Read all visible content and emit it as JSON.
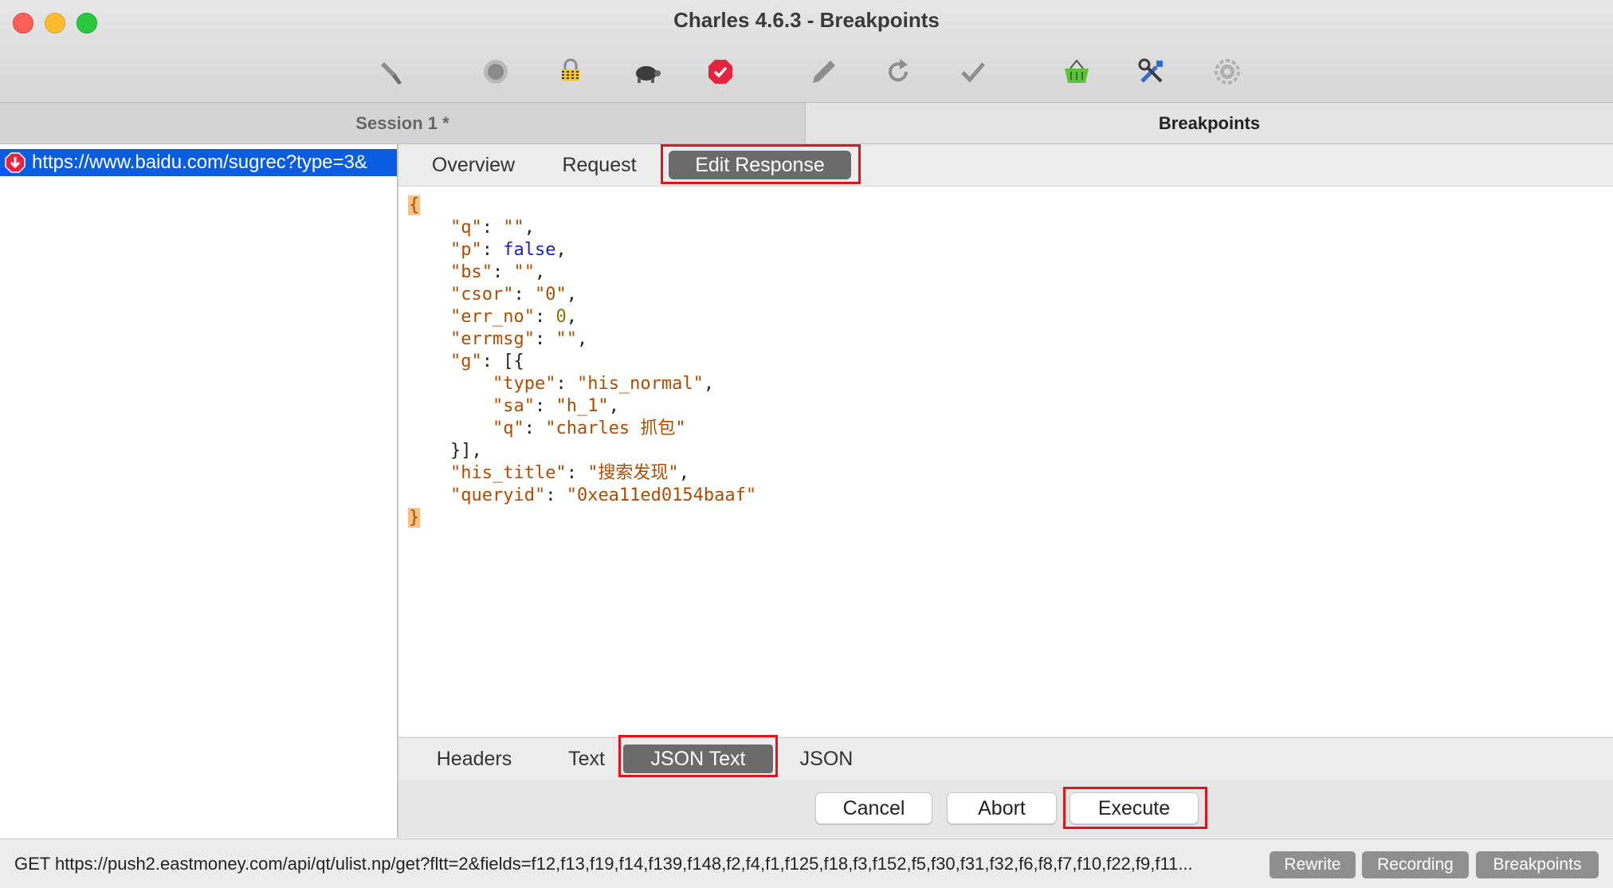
{
  "window": {
    "title": "Charles 4.6.3 - Breakpoints"
  },
  "toolbar": {
    "tools": [
      {
        "name": "broom-icon"
      },
      {
        "name": "record-icon"
      },
      {
        "name": "ssl-lock-icon"
      },
      {
        "name": "throttle-turtle-icon"
      },
      {
        "name": "breakpoints-stop-icon"
      },
      {
        "name": "compose-pen-icon"
      },
      {
        "name": "repeat-icon"
      },
      {
        "name": "validate-check-icon"
      },
      {
        "name": "basket-icon"
      },
      {
        "name": "tools-icon"
      },
      {
        "name": "settings-gear-icon"
      }
    ]
  },
  "sessions": {
    "session_tab": "Session 1 *",
    "breakpoints_tab": "Breakpoints"
  },
  "left_list": {
    "selected_url": "https://www.baidu.com/sugrec?type=3&"
  },
  "detail_tabs": {
    "overview": "Overview",
    "request": "Request",
    "edit_response": "Edit Response"
  },
  "editor": {
    "json_lines": [
      {
        "indent": 0,
        "text": "{"
      },
      {
        "indent": 1,
        "key": "\"q\"",
        "sep": ": ",
        "value": "\"\"",
        "vtype": "s",
        "end": ","
      },
      {
        "indent": 1,
        "key": "\"p\"",
        "sep": ": ",
        "value": "false",
        "vtype": "kw",
        "end": ","
      },
      {
        "indent": 1,
        "key": "\"bs\"",
        "sep": ": ",
        "value": "\"\"",
        "vtype": "s",
        "end": ","
      },
      {
        "indent": 1,
        "key": "\"csor\"",
        "sep": ": ",
        "value": "\"0\"",
        "vtype": "s",
        "end": ","
      },
      {
        "indent": 1,
        "key": "\"err_no\"",
        "sep": ": ",
        "value": "0",
        "vtype": "n",
        "end": ","
      },
      {
        "indent": 1,
        "key": "\"errmsg\"",
        "sep": ": ",
        "value": "\"\"",
        "vtype": "s",
        "end": ","
      },
      {
        "indent": 1,
        "key": "\"g\"",
        "sep": ": ",
        "value": "[{",
        "vtype": "p",
        "end": ""
      },
      {
        "indent": 2,
        "key": "\"type\"",
        "sep": ": ",
        "value": "\"his_normal\"",
        "vtype": "s",
        "end": ","
      },
      {
        "indent": 2,
        "key": "\"sa\"",
        "sep": ": ",
        "value": "\"h_1\"",
        "vtype": "s",
        "end": ","
      },
      {
        "indent": 2,
        "key": "\"q\"",
        "sep": ": ",
        "value": "\"charles 抓包\"",
        "vtype": "s",
        "end": ""
      },
      {
        "indent": 1,
        "key": "",
        "sep": "",
        "value": "}],",
        "vtype": "p",
        "end": ""
      },
      {
        "indent": 1,
        "key": "\"his_title\"",
        "sep": ": ",
        "value": "\"搜索发现\"",
        "vtype": "s",
        "end": ","
      },
      {
        "indent": 1,
        "key": "\"queryid\"",
        "sep": ": ",
        "value": "\"0xea11ed0154baaf\"",
        "vtype": "s",
        "end": ""
      },
      {
        "indent": 0,
        "text": "}"
      }
    ]
  },
  "format_tabs": {
    "headers": "Headers",
    "text": "Text",
    "json_text": "JSON Text",
    "json": "JSON"
  },
  "actions": {
    "cancel": "Cancel",
    "abort": "Abort",
    "execute": "Execute"
  },
  "statusbar": {
    "text": "GET https://push2.eastmoney.com/api/qt/ulist.np/get?fltt=2&fields=f12,f13,f19,f14,f139,f148,f2,f4,f1,f125,f18,f3,f152,f5,f30,f31,f32,f6,f8,f7,f10,f22,f9,f11...",
    "rewrite": "Rewrite",
    "recording": "Recording",
    "breakpoints": "Breakpoints"
  },
  "colors": {
    "selection": "#0a5ce0",
    "highlight_box": "#e0141b",
    "active_tab": "#6b6b6b"
  }
}
